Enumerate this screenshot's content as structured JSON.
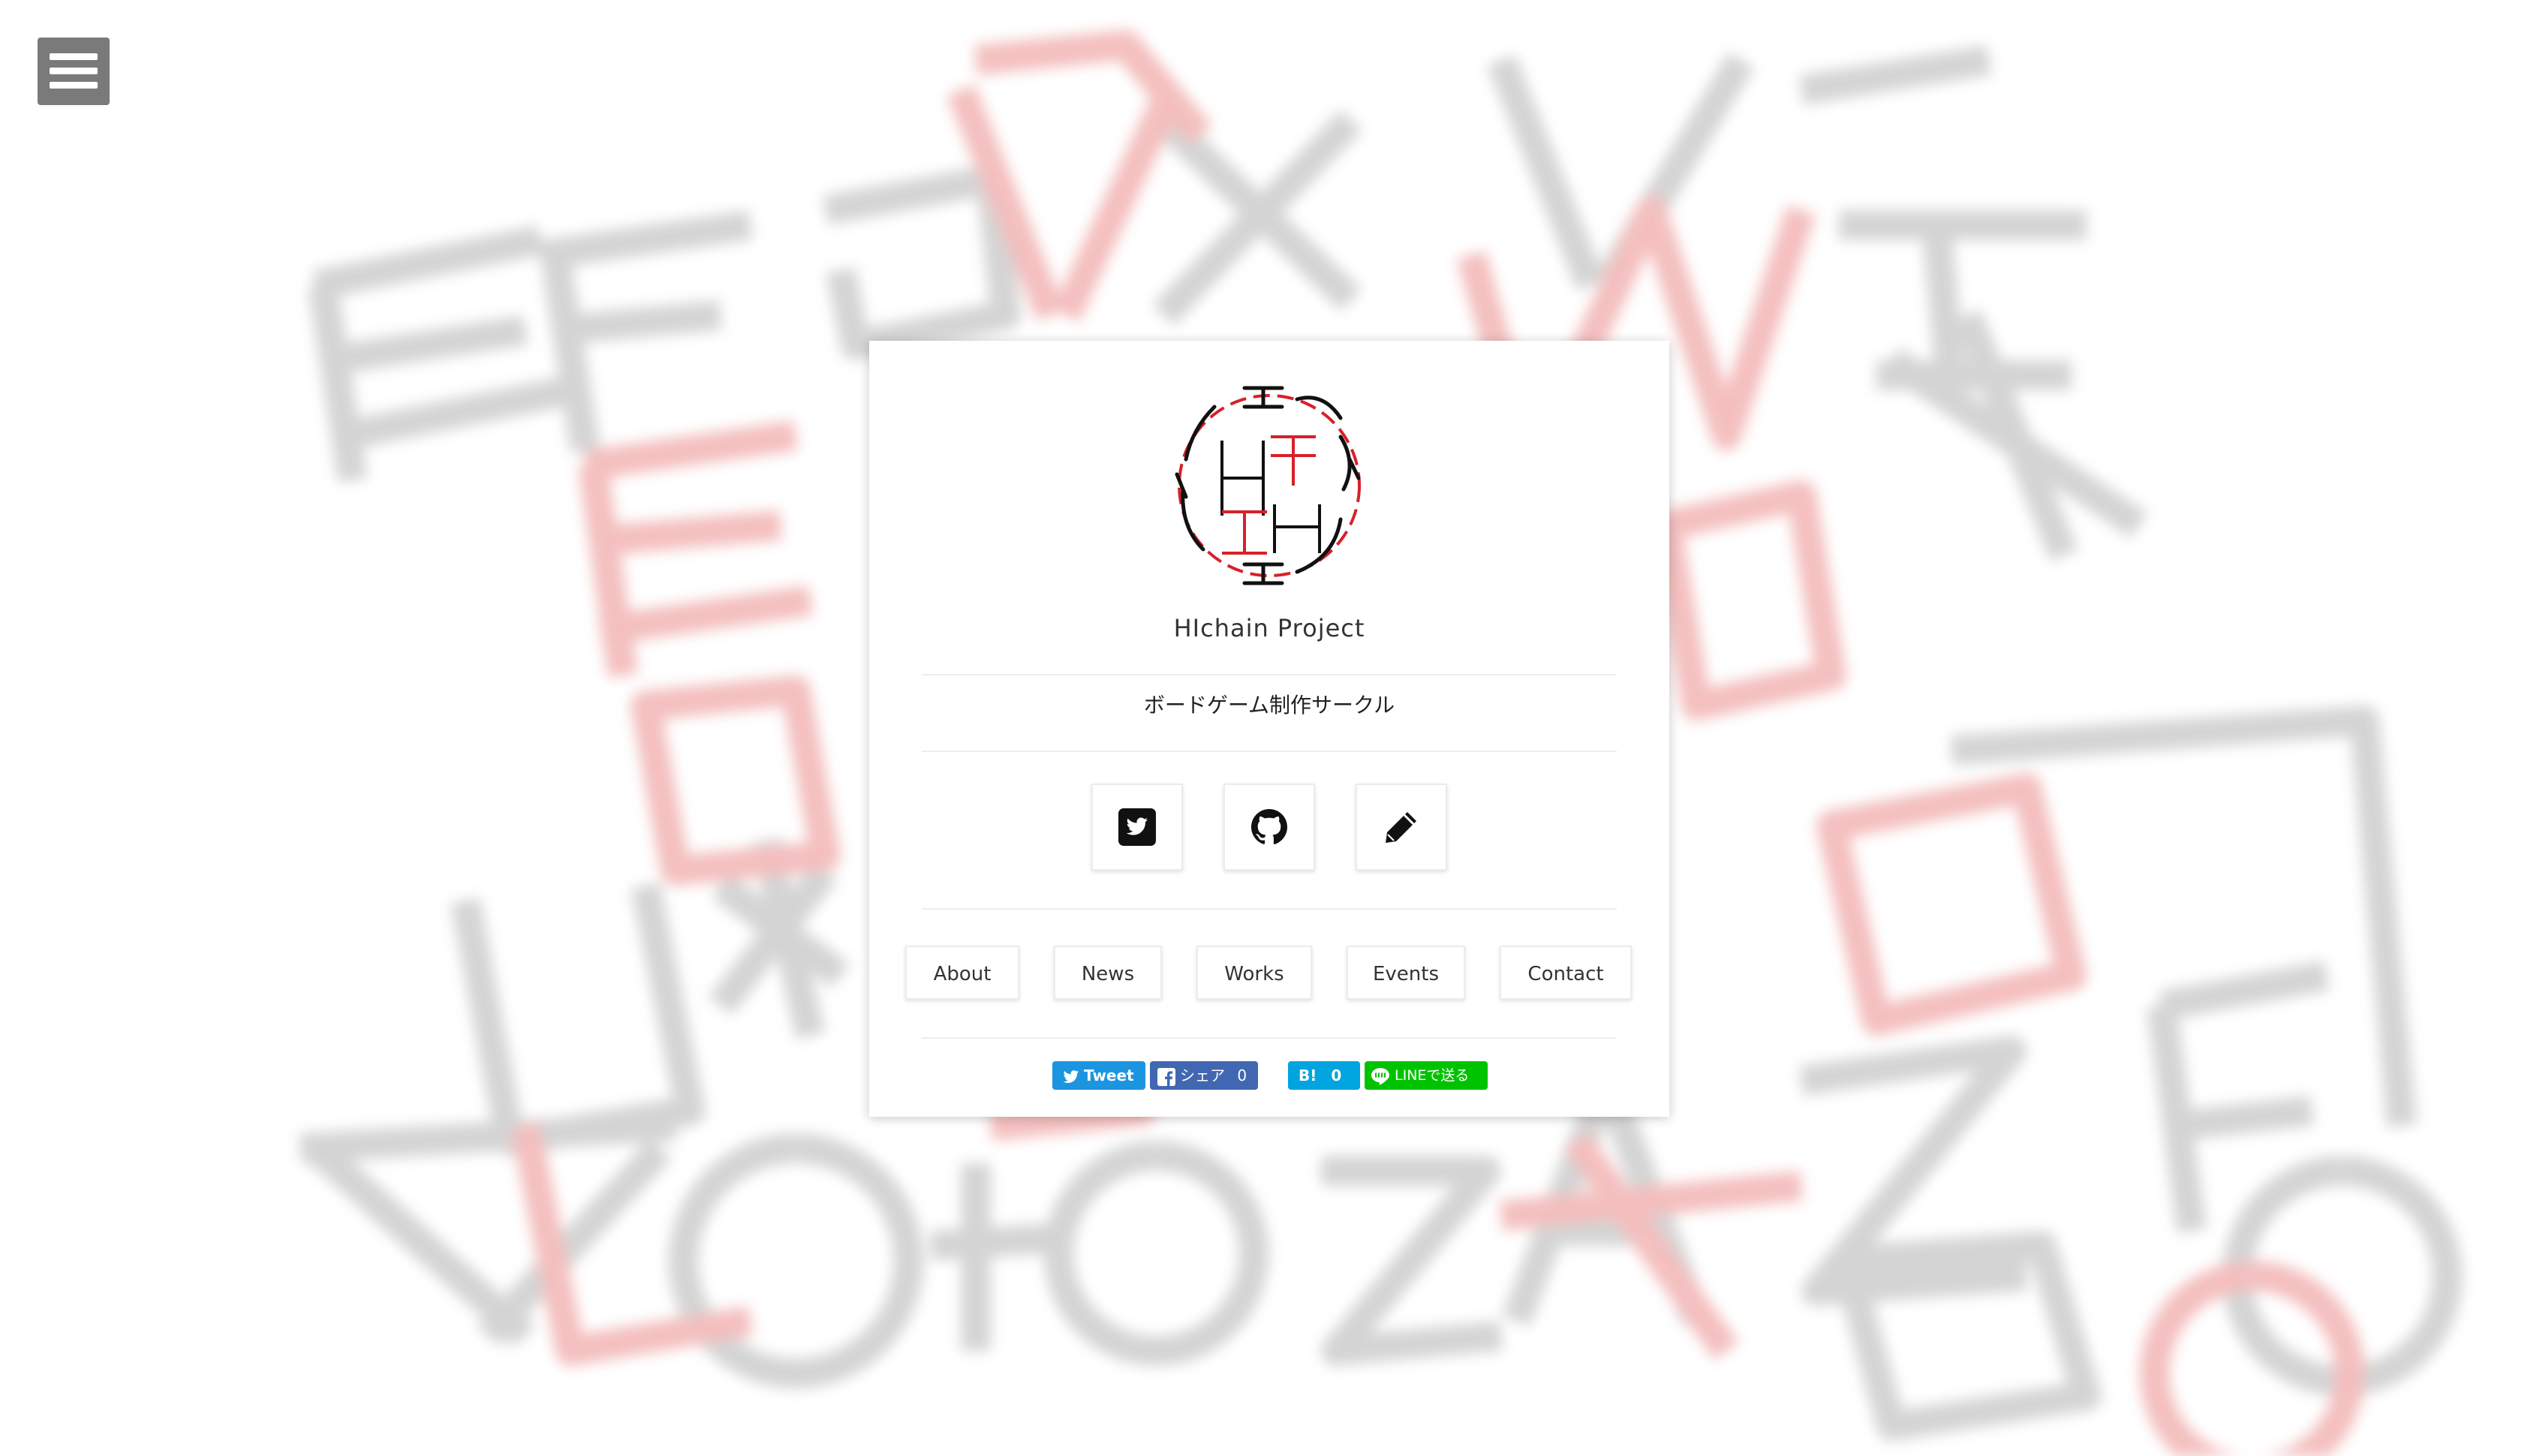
{
  "menu": {
    "icon": "hamburger-menu-icon"
  },
  "site": {
    "title": "HIchain Project",
    "subtitle": "ボードゲーム制作サークル"
  },
  "social_links": [
    {
      "icon": "twitter-icon"
    },
    {
      "icon": "github-icon"
    },
    {
      "icon": "pencil-icon"
    }
  ],
  "nav": {
    "items": [
      "About",
      "News",
      "Works",
      "Events",
      "Contact"
    ]
  },
  "share": {
    "twitter_label": "Tweet",
    "facebook_label": "シェア",
    "facebook_count": "0",
    "hatena_label": "B!",
    "hatena_count": "0",
    "line_label": "LINEで送る"
  },
  "colors": {
    "accent_red": "#d8202a",
    "twitter": "#1b95e0",
    "facebook": "#4267b2",
    "hatena": "#00a4de",
    "line": "#00c300"
  }
}
